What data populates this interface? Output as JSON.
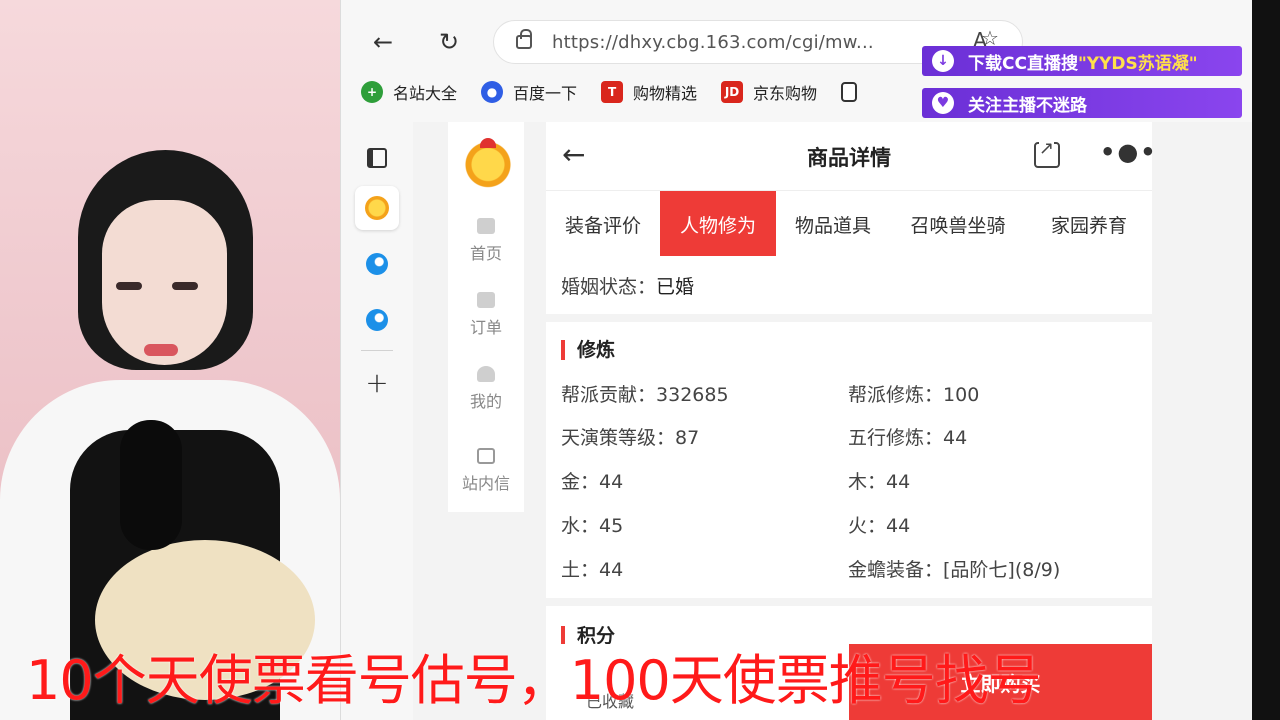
{
  "browser": {
    "url": "https://dhxy.cbg.163.com/cgi/mw...",
    "bookmarks": [
      {
        "label": "名站大全",
        "icon": "plus-circle-icon",
        "color": "#2e9e3a"
      },
      {
        "label": "百度一下",
        "icon": "baidu-paw-icon",
        "color": "#2f5ee5"
      },
      {
        "label": "购物精选",
        "icon": "t-logo-icon",
        "color": "#d9261c"
      },
      {
        "label": "京东购物",
        "icon": "jd-logo-icon",
        "color": "#d9261c"
      },
      {
        "label": "",
        "icon": "page-icon",
        "color": "#ffffff"
      }
    ]
  },
  "app_side": {
    "items": [
      {
        "label": "首页"
      },
      {
        "label": "订单"
      },
      {
        "label": "我的"
      },
      {
        "label": "站内信"
      }
    ]
  },
  "detail": {
    "title": "商品详情",
    "tabs": [
      {
        "label": "装备评价",
        "active": false
      },
      {
        "label": "人物修为",
        "active": true
      },
      {
        "label": "物品道具",
        "active": false
      },
      {
        "label": "召唤兽坐骑",
        "active": false
      },
      {
        "label": "家园养育",
        "active": false
      }
    ],
    "marriage": {
      "label": "婚姻状态：",
      "value": "已婚"
    },
    "cultivation": {
      "title": "修炼",
      "items": [
        {
          "label": "帮派贡献：",
          "value": "332685"
        },
        {
          "label": "帮派修炼：",
          "value": "100"
        },
        {
          "label": "天演策等级：",
          "value": "87"
        },
        {
          "label": "五行修炼：",
          "value": "44"
        },
        {
          "label": "金：",
          "value": "44"
        },
        {
          "label": "木：",
          "value": "44"
        },
        {
          "label": "水：",
          "value": "45"
        },
        {
          "label": "火：",
          "value": "44"
        },
        {
          "label": "土：",
          "value": "44"
        },
        {
          "label": "金蟾装备：",
          "value": "[品阶七](8/9)"
        }
      ]
    },
    "score_title": "积分",
    "favorite_label": "已收藏",
    "buy_label": "立即购买"
  },
  "overlays": {
    "download_prefix": "下载CC直播搜",
    "download_highlight": "\"YYDS苏语凝\"",
    "follow": "关注主播不迷路"
  },
  "caption": "10个天使票看号估号，100天使票推号找号",
  "colors": {
    "accent": "#ee3b37",
    "overlay": "#7b3ae0",
    "caption": "#ff1a1a"
  }
}
